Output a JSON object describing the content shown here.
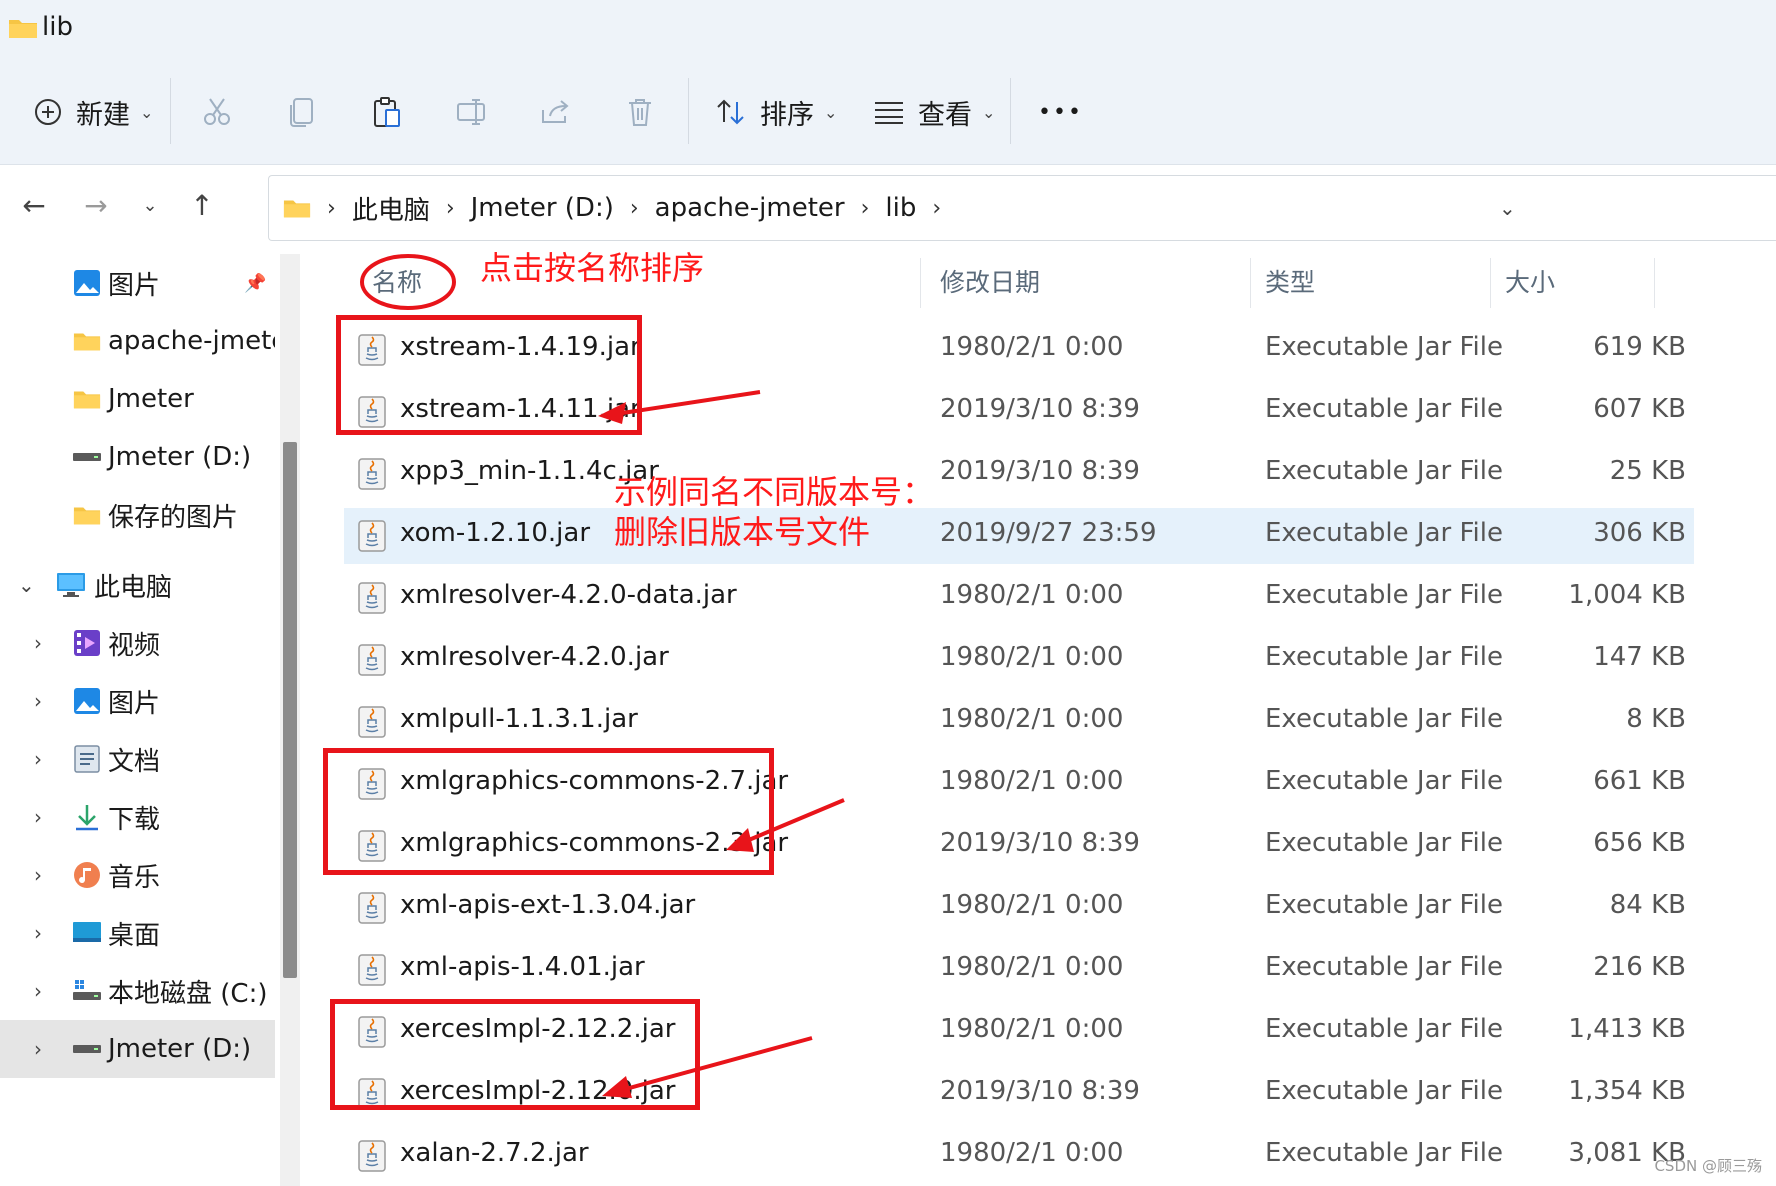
{
  "window": {
    "title": "lib"
  },
  "toolbar": {
    "new_label": "新建",
    "sort_label": "排序",
    "view_label": "查看",
    "more_label": "•••"
  },
  "address": {
    "crumbs": [
      "此电脑",
      "Jmeter (D:)",
      "apache-jmeter",
      "lib"
    ]
  },
  "sidebar": {
    "items": [
      {
        "label": "图片",
        "icon": "pictures-icon"
      },
      {
        "label": "apache-jmeter",
        "icon": "folder-icon"
      },
      {
        "label": "Jmeter",
        "icon": "folder-icon"
      },
      {
        "label": "Jmeter (D:)",
        "icon": "drive-icon"
      },
      {
        "label": "保存的图片",
        "icon": "folder-icon"
      },
      {
        "label": "此电脑",
        "icon": "computer-icon"
      },
      {
        "label": "视频",
        "icon": "video-icon"
      },
      {
        "label": "图片",
        "icon": "pictures-icon"
      },
      {
        "label": "文档",
        "icon": "documents-icon"
      },
      {
        "label": "下载",
        "icon": "download-icon"
      },
      {
        "label": "音乐",
        "icon": "music-icon"
      },
      {
        "label": "桌面",
        "icon": "desktop-icon"
      },
      {
        "label": "本地磁盘 (C:)",
        "icon": "system-drive-icon"
      },
      {
        "label": "Jmeter (D:)",
        "icon": "drive-icon"
      }
    ]
  },
  "columns": {
    "name": "名称",
    "date": "修改日期",
    "type": "类型",
    "size": "大小"
  },
  "files": [
    {
      "name": "xstream-1.4.19.jar",
      "date": "1980/2/1 0:00",
      "type": "Executable Jar File",
      "size": "619 KB"
    },
    {
      "name": "xstream-1.4.11.jar",
      "date": "2019/3/10 8:39",
      "type": "Executable Jar File",
      "size": "607 KB"
    },
    {
      "name": "xpp3_min-1.1.4c.jar",
      "date": "2019/3/10 8:39",
      "type": "Executable Jar File",
      "size": "25 KB"
    },
    {
      "name": "xom-1.2.10.jar",
      "date": "2019/9/27 23:59",
      "type": "Executable Jar File",
      "size": "306 KB"
    },
    {
      "name": "xmlresolver-4.2.0-data.jar",
      "date": "1980/2/1 0:00",
      "type": "Executable Jar File",
      "size": "1,004 KB"
    },
    {
      "name": "xmlresolver-4.2.0.jar",
      "date": "1980/2/1 0:00",
      "type": "Executable Jar File",
      "size": "147 KB"
    },
    {
      "name": "xmlpull-1.1.3.1.jar",
      "date": "1980/2/1 0:00",
      "type": "Executable Jar File",
      "size": "8 KB"
    },
    {
      "name": "xmlgraphics-commons-2.7.jar",
      "date": "1980/2/1 0:00",
      "type": "Executable Jar File",
      "size": "661 KB"
    },
    {
      "name": "xmlgraphics-commons-2.3.jar",
      "date": "2019/3/10 8:39",
      "type": "Executable Jar File",
      "size": "656 KB"
    },
    {
      "name": "xml-apis-ext-1.3.04.jar",
      "date": "1980/2/1 0:00",
      "type": "Executable Jar File",
      "size": "84 KB"
    },
    {
      "name": "xml-apis-1.4.01.jar",
      "date": "1980/2/1 0:00",
      "type": "Executable Jar File",
      "size": "216 KB"
    },
    {
      "name": "xercesImpl-2.12.2.jar",
      "date": "1980/2/1 0:00",
      "type": "Executable Jar File",
      "size": "1,413 KB"
    },
    {
      "name": "xercesImpl-2.12.0.jar",
      "date": "2019/3/10 8:39",
      "type": "Executable Jar File",
      "size": "1,354 KB"
    },
    {
      "name": "xalan-2.7.2.jar",
      "date": "1980/2/1 0:00",
      "type": "Executable Jar File",
      "size": "3,081 KB"
    }
  ],
  "annotations": {
    "sort_hint": "点击按名称排序",
    "example_line1": "示例同名不同版本号：",
    "example_line2": "删除旧版本号文件",
    "color": "#ff1a1a"
  },
  "watermark": "CSDN @顾三殇"
}
